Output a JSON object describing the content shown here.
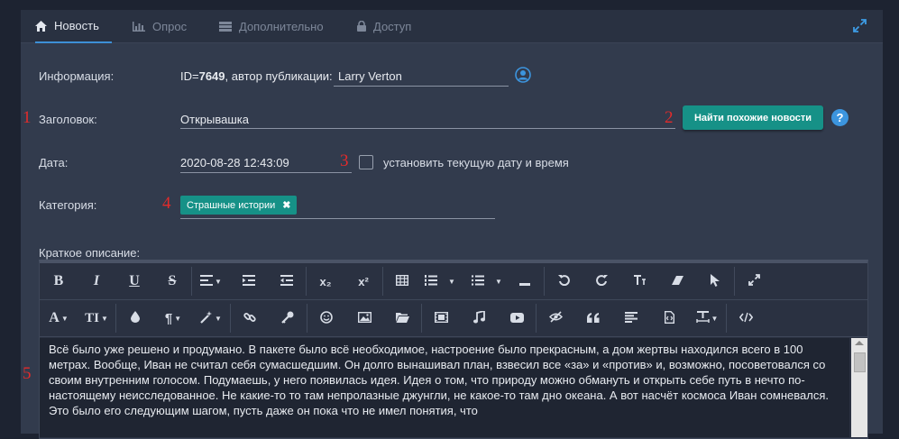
{
  "tabs": [
    {
      "label": "Новость",
      "icon": "home-icon",
      "active": true
    },
    {
      "label": "Опрос",
      "icon": "bar-chart-icon",
      "active": false
    },
    {
      "label": "Дополнительно",
      "icon": "server-icon",
      "active": false
    },
    {
      "label": "Доступ",
      "icon": "lock-icon",
      "active": false
    }
  ],
  "form": {
    "info_label": "Информация:",
    "id_prefix": "ID=",
    "id_value": "7649",
    "author_text": ", автор публикации:",
    "author_name": "Larry Verton",
    "title_label": "Заголовок:",
    "title_value": "Открывашка",
    "find_similar_button": "Найти похожие новости",
    "help_icon_text": "?",
    "date_label": "Дата:",
    "date_value": "2020-08-28 12:43:09",
    "set_current_date_label": "установить текущую дату и время",
    "category_label": "Категория:",
    "category_tag": "Страшные истории",
    "category_tag_remove": "✖",
    "short_desc_label": "Краткое описание:"
  },
  "annotations": [
    "1",
    "2",
    "3",
    "4",
    "5"
  ],
  "editor": {
    "content": "Всё было уже решено и продумано. В пакете было всё необходимое, настроение было прекрасным, а дом жертвы находился всего в 100 метрах. Вообще, Иван не считал себя сумасшедшим. Он долго вынашивал план, взвесил все «за» и «против» и, возможно, посоветовался со своим внутренним голосом. Подумаешь, у него появилась идея. Идея о том, что природу можно обмануть и открыть себе путь в нечто по-настоящему неисследованное. Не какие-то то там непролазные джунгли, не какое-то там дно океана. А вот насчёт космоса Иван сомневался. Это было его следующим шагом, пусть даже он пока что не имел понятия, что",
    "toolbar_row1": [
      "B",
      "I",
      "U",
      "S",
      "x₂",
      "x²"
    ],
    "toolbar_row2": [
      "A",
      "TI"
    ]
  },
  "colors": {
    "accent": "#169187",
    "tab_active": "#3d8fd6",
    "annotation": "#e22b2b"
  }
}
